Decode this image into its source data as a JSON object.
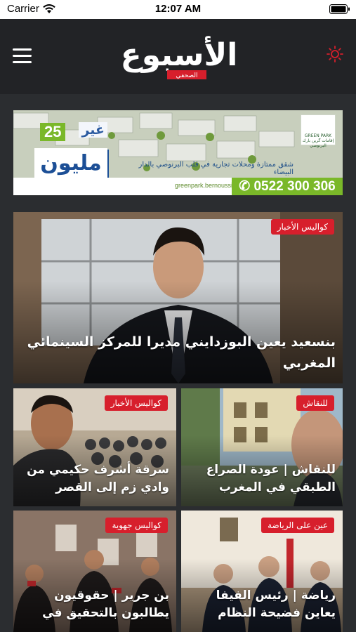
{
  "status_bar": {
    "carrier": "Carrier",
    "time": "12:07 AM"
  },
  "header": {
    "logo_text": "الأسبوع",
    "logo_sub": "الصحفي",
    "menu_icon": "hamburger-icon",
    "theme_icon": "sun-icon"
  },
  "ad": {
    "price_prefix": "غير",
    "price_number": "25",
    "price_unit": "مليون",
    "logo_name": "GREEN PARK",
    "logo_sub": "إقامات گرين بارك البرنوصي",
    "tagline": "شقق ممتازة ومحلات تجارية في قلب البرنوصي بالدار البيضاء",
    "website": "greenpark.bernoussi",
    "phone": "0522 300 306",
    "colors": {
      "green": "#7ab829",
      "blue": "#1c4f96"
    }
  },
  "articles": [
    {
      "category": "كواليس الأخبار",
      "title": "بنسعيد يعين البوزدايني مديرا للمركز السينمائي المغربي"
    },
    {
      "category": "للنقاش",
      "title": "للنقاش | عودة الصراع الطبقي في المغرب"
    },
    {
      "category": "كواليس الأخبار",
      "title": "سرقة أشرف حكيمي من وادي زم إلى القصر"
    },
    {
      "category": "عين على الرياضة",
      "title": "رياضة | رئيس الفيفا يعاين فضيحة النظام"
    },
    {
      "category": "كواليس جهوية",
      "title": "بن جرير | حقوقيون يطالبون بالتحقيق في"
    }
  ],
  "colors": {
    "badge": "#d71f2c",
    "header_bg": "#222326",
    "page_bg": "#2b2d30"
  }
}
